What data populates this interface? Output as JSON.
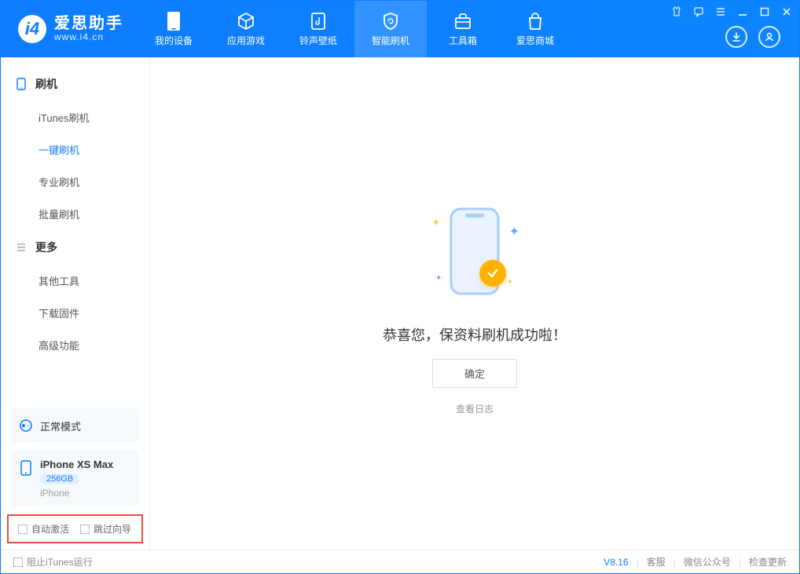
{
  "header": {
    "app_name_cn": "爱思助手",
    "app_name_en": "www.i4.cn",
    "tabs": [
      {
        "label": "我的设备"
      },
      {
        "label": "应用游戏"
      },
      {
        "label": "铃声壁纸"
      },
      {
        "label": "智能刷机"
      },
      {
        "label": "工具箱"
      },
      {
        "label": "爱思商城"
      }
    ]
  },
  "sidebar": {
    "group1_title": "刷机",
    "items1": [
      {
        "label": "iTunes刷机"
      },
      {
        "label": "一键刷机"
      },
      {
        "label": "专业刷机"
      },
      {
        "label": "批量刷机"
      }
    ],
    "group2_title": "更多",
    "items2": [
      {
        "label": "其他工具"
      },
      {
        "label": "下载固件"
      },
      {
        "label": "高级功能"
      }
    ],
    "mode_label": "正常模式",
    "device_name": "iPhone XS Max",
    "device_capacity": "256GB",
    "device_model": "iPhone",
    "auto_activate": "自动激活",
    "skip_guide": "跳过向导"
  },
  "main": {
    "success_text": "恭喜您，保资料刷机成功啦！",
    "ok_button": "确定",
    "view_log": "查看日志"
  },
  "status": {
    "block_itunes": "阻止iTunes运行",
    "version": "V8.16",
    "support": "客服",
    "wechat": "微信公众号",
    "update": "检查更新"
  }
}
